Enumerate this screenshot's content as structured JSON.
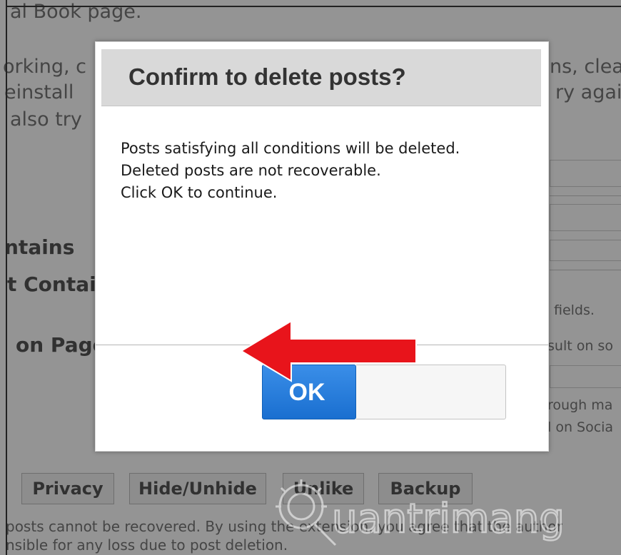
{
  "background": {
    "lines": [
      "al Book page.",
      "orking, c",
      "einstall",
      "also try"
    ],
    "right_lines": [
      "ns, clea",
      "ry agai"
    ],
    "labels": {
      "contains": "ntains",
      "not_contains": "t Contai",
      "on_page": "on Page"
    },
    "right_notes": {
      "fields": "fields.",
      "result": "sult on so",
      "through": "rough ma",
      "social": "l on Socia"
    },
    "buttons": {
      "privacy": "Privacy",
      "hide_unhide": "Hide/Unhide",
      "unlike": "Unlike",
      "backup": "Backup"
    },
    "footer": [
      "posts cannot be recovered. By using the extension, you agree that the author",
      "nsible for any loss due to post deletion."
    ]
  },
  "dialog": {
    "title": "Confirm to delete posts?",
    "message_lines": [
      "Posts satisfying all conditions will be deleted.",
      "Deleted posts are not recoverable.",
      "Click OK to continue."
    ],
    "ok_label": "OK",
    "cancel_label": ""
  },
  "annotation": {
    "arrow_color": "#e8141b"
  },
  "watermark": {
    "text": "uantrimang"
  }
}
